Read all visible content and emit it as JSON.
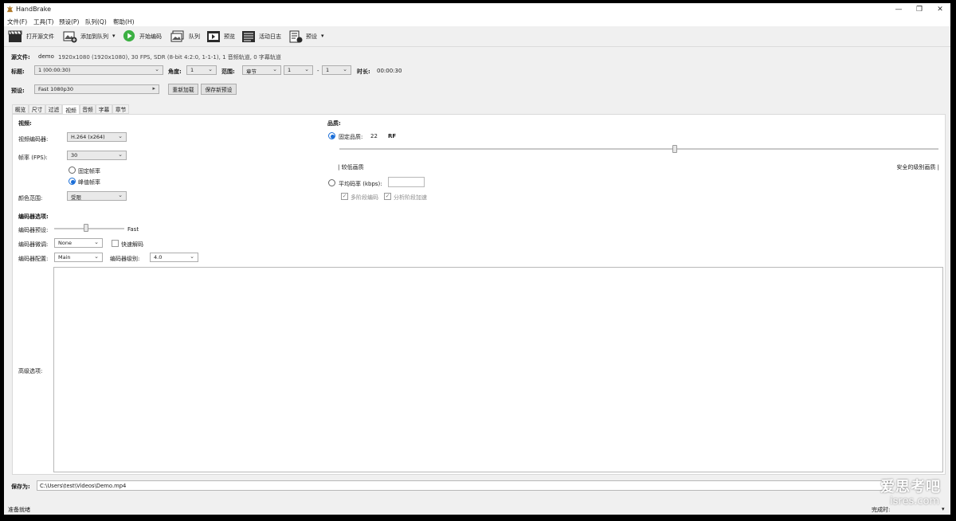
{
  "window": {
    "title": "HandBrake",
    "minimize": "—",
    "maximize": "❐",
    "close": "✕"
  },
  "menu": [
    "文件(F)",
    "工具(T)",
    "预设(P)",
    "队列(Q)",
    "帮助(H)"
  ],
  "toolbar": {
    "open_source": "打开源文件",
    "add_to_queue": "添加到队列",
    "start_encode": "开始编码",
    "queue": "队列",
    "preview": "预览",
    "activity_log": "活动日志",
    "presets": "预设",
    "caret": "▾"
  },
  "source": {
    "label": "源文件:",
    "name": "demo",
    "info": "1920x1080 (1920x1080), 30 FPS, SDR (8-bit 4:2:0, 1-1-1), 1 音频轨道, 0 字幕轨道"
  },
  "title_row": {
    "title_label": "标题:",
    "title_value": "1 (00:00:30)",
    "angle_label": "角度:",
    "angle_value": "1",
    "range_label": "范围:",
    "range_type": "章节",
    "range_start": "1",
    "range_dash": "-",
    "range_end": "1",
    "duration_label": "时长:",
    "duration_value": "00:00:30"
  },
  "preset_row": {
    "label": "预设:",
    "value": "Fast 1080p30",
    "reload": "重新加载",
    "save_new": "保存新预设",
    "arrow": "▸"
  },
  "tabs": [
    "概览",
    "尺寸",
    "过滤",
    "视频",
    "音频",
    "字幕",
    "章节"
  ],
  "active_tab": "视频",
  "video": {
    "section": "视频:",
    "encoder_label": "视频编码器:",
    "encoder_value": "H.264 (x264)",
    "fps_label": "帧率 (FPS):",
    "fps_value": "30",
    "constant_fr": "固定帧率",
    "peak_fr": "峰值帧率",
    "color_label": "颜色范围:",
    "color_value": "受限"
  },
  "quality": {
    "section": "品质:",
    "constant_label": "固定品质:",
    "constant_value": "22",
    "rf": "RF",
    "slider_fraction": 0.56,
    "low_label": "| 较低画质",
    "high_label": "安全的级别画质 |",
    "avg_label": "平均码率 (kbps):",
    "avg_value": "",
    "multipass": "多阶段编码",
    "turbo": "分析阶段加速"
  },
  "encoder_options": {
    "section": "编码器选项:",
    "preset_label": "编码器预设:",
    "preset_value": "Fast",
    "preset_fraction": 0.45,
    "tune_label": "编码器微调:",
    "tune_value": "None",
    "fast_decode": "快速解码",
    "profile_label": "编码器配置:",
    "profile_value": "Main",
    "level_label": "编码器级别:",
    "level_value": "4.0",
    "advanced_label": "高级选项:"
  },
  "save": {
    "label": "保存为:",
    "path": "C:\\Users\\test\\Videos\\Demo.mp4"
  },
  "status": {
    "left": "准备就绪",
    "right": "完成时:",
    "right_caret": "▾"
  },
  "watermark": {
    "line1": "爱思考吧",
    "line2": "isres.com"
  },
  "colors": {
    "accent": "#1a6ed8",
    "start_green": "#3cb043",
    "panel_bg": "#ffffff",
    "window_bg": "#f0f0f0"
  }
}
